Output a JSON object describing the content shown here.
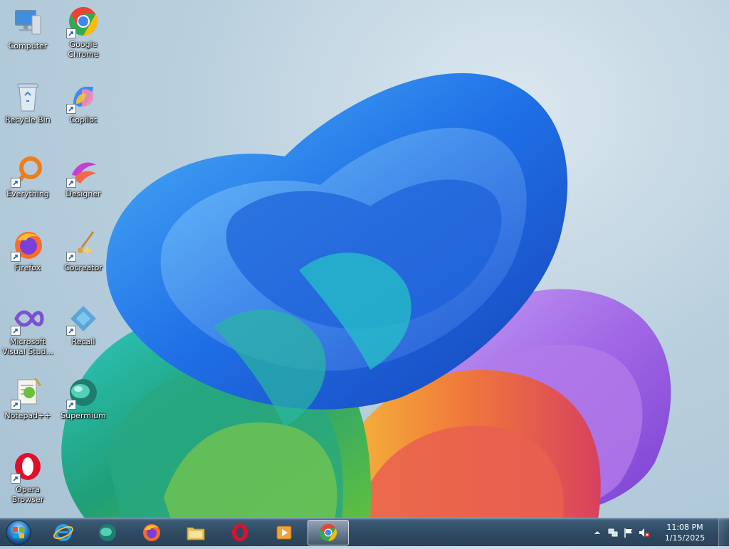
{
  "desktop": {
    "icons": [
      {
        "label": "Computer"
      },
      {
        "label": "Google Chrome"
      },
      {
        "label": "Recycle Bin"
      },
      {
        "label": "Copilot"
      },
      {
        "label": "Everything"
      },
      {
        "label": "Designer"
      },
      {
        "label": "Firefox"
      },
      {
        "label": "Cocreator"
      },
      {
        "label": "Microsoft Visual Stud..."
      },
      {
        "label": "Recall"
      },
      {
        "label": "Notepad++"
      },
      {
        "label": "Supermium"
      },
      {
        "label": "Opera Browser"
      }
    ]
  },
  "taskbar": {
    "pinned": [
      {
        "icon": "internet-explorer-icon"
      },
      {
        "icon": "supermium-icon"
      },
      {
        "icon": "firefox-icon"
      },
      {
        "icon": "file-explorer-icon"
      },
      {
        "icon": "opera-icon"
      },
      {
        "icon": "media-player-icon"
      },
      {
        "icon": "chrome-icon",
        "active": true
      }
    ],
    "clock": {
      "time": "11:08 PM",
      "date": "1/15/2025"
    }
  },
  "colors": {
    "taskbar": "#2f4a63",
    "wallpaper_bg": "#b9cfdd"
  }
}
